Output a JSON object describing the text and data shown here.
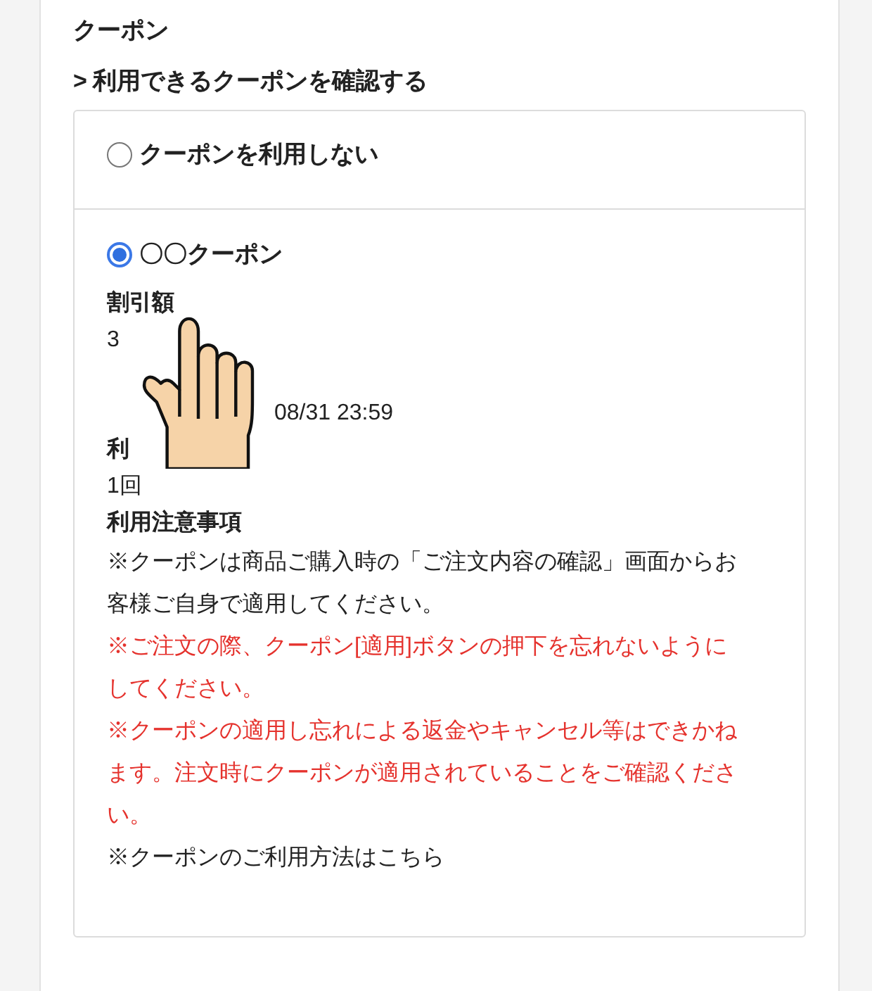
{
  "section_title": "クーポン",
  "link": {
    "icon": ">",
    "label": "利用できるクーポンを確認する"
  },
  "options": [
    {
      "label": "クーポンを利用しない",
      "selected": false
    },
    {
      "label": "〇〇クーポン",
      "selected": true,
      "details": [
        {
          "kind": "label",
          "text": "割引額"
        },
        {
          "kind": "value",
          "text": "3"
        },
        {
          "kind": "blank"
        },
        {
          "kind": "blank"
        },
        {
          "kind": "value_hidden_start",
          "text": "08/31 23:59"
        },
        {
          "kind": "label",
          "text": "利"
        },
        {
          "kind": "value",
          "text": "1回"
        },
        {
          "kind": "label",
          "text": "利用注意事項"
        },
        {
          "kind": "note",
          "text": "※クーポンは商品ご購入時の「ご注文内容の確認」画面からお客様ご自身で適用してください。"
        },
        {
          "kind": "warning",
          "text": "※ご注文の際、クーポン[適用]ボタンの押下を忘れないようにしてください。"
        },
        {
          "kind": "warning",
          "text": "※クーポンの適用し忘れによる返金やキャンセル等はできかねます。注文時にクーポンが適用されていることをご確認ください。"
        },
        {
          "kind": "note",
          "text": "※クーポンのご利用方法はこちら"
        }
      ]
    }
  ]
}
